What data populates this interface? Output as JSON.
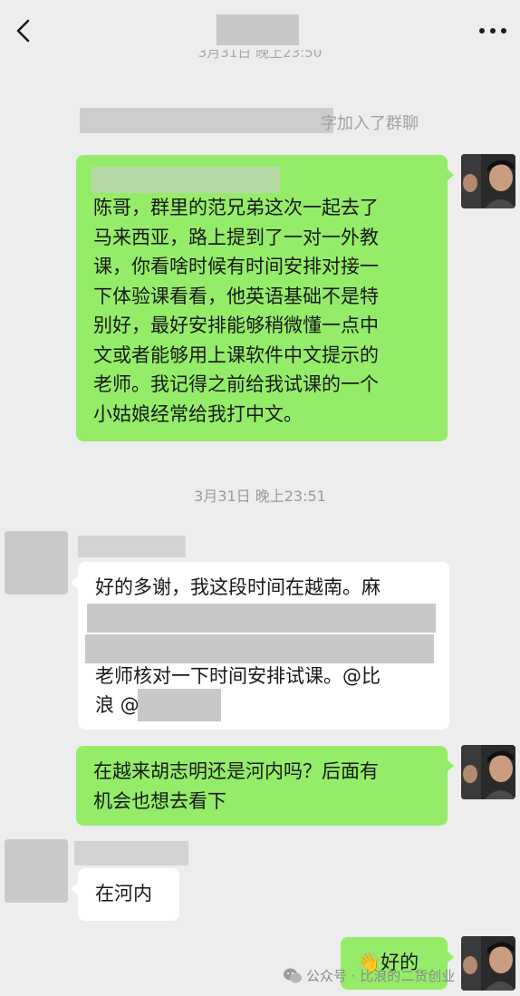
{
  "header": {
    "back_icon": "chevron-left-icon",
    "more_icon": "more-dots-icon"
  },
  "timestamps": {
    "top_partial": "3月31日 晚上23:50",
    "middle": "3月31日 晚上23:51"
  },
  "system": {
    "join_notice_tail": "字加入了群聊"
  },
  "messages": {
    "m1": {
      "line1": "陈哥，群里的范兄弟这次一起去了",
      "line2": "马来西亚，路上提到了一对一外教",
      "line3": "课，你看啥时候有时间安排对接一",
      "line4": "下体验课看看，他英语基础不是特",
      "line5": "别好，最好安排能够稍微懂一点中",
      "line6": "文或者能够用上课软件中文提示的",
      "line7": "老师。我记得之前给我试课的一个",
      "line8": "小姑娘经常给我打中文。"
    },
    "m2": {
      "line1": "好的多谢，我这段时间在越南。麻",
      "line4": "老师核对一下时间安排试课。@比",
      "line5": "浪 @"
    },
    "m3": {
      "line1": "在越来胡志明还是河内吗？后面有",
      "line2": "机会也想去看下"
    },
    "m4": {
      "text": "在河内"
    },
    "m5": {
      "emoji": "👋",
      "text": "好的"
    }
  },
  "watermark": {
    "icon": "wechat-icon",
    "text": "公众号 · 比浪的二货创业"
  },
  "colors": {
    "background": "#ededed",
    "bubble_self": "#95ec69",
    "bubble_other": "#ffffff",
    "redaction": "#c8c8c8"
  }
}
